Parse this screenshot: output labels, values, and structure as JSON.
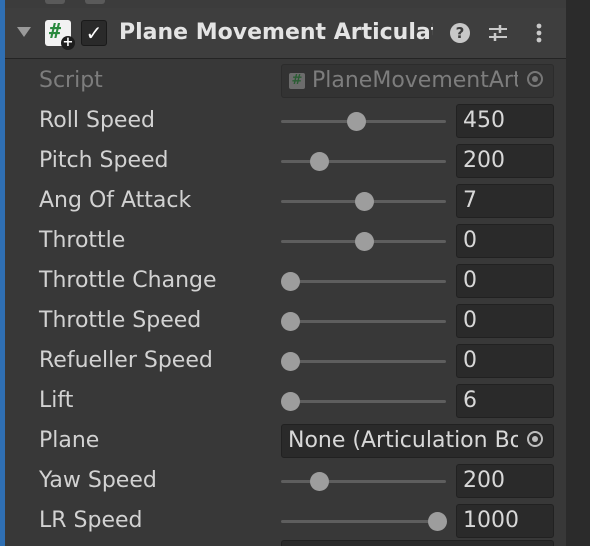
{
  "component": {
    "title": "Plane Movement Articulation",
    "enabled": true,
    "help_icon": "help-icon",
    "preset_icon": "sliders-icon",
    "menu_icon": "kebab-menu-icon"
  },
  "script_field": {
    "label": "Script",
    "value": "PlaneMovementArticulation"
  },
  "fields": [
    {
      "label": "Roll Speed",
      "value": "450",
      "slider_fraction": 0.45
    },
    {
      "label": "Pitch Speed",
      "value": "200",
      "slider_fraction": 0.2
    },
    {
      "label": "Ang Of Attack",
      "value": "7",
      "slider_fraction": 0.5
    },
    {
      "label": "Throttle",
      "value": "0",
      "slider_fraction": 0.5
    },
    {
      "label": "Throttle Change",
      "value": "0",
      "slider_fraction": 0.0
    },
    {
      "label": "Throttle Speed",
      "value": "0",
      "slider_fraction": 0.0
    },
    {
      "label": "Refueller Speed",
      "value": "0",
      "slider_fraction": 0.0
    },
    {
      "label": "Lift",
      "value": "6",
      "slider_fraction": 0.0
    }
  ],
  "plane_field": {
    "label": "Plane",
    "value": "None (Articulation Body)"
  },
  "fields2": [
    {
      "label": "Yaw Speed",
      "value": "200",
      "slider_fraction": 0.2
    },
    {
      "label": "LR Speed",
      "value": "1000",
      "slider_fraction": 1.0
    }
  ],
  "colors": {
    "background": "#383838",
    "accent_strip": "#2f6fb3",
    "field_bg": "#2a2a2a",
    "slider_thumb": "#9d9d9d"
  }
}
